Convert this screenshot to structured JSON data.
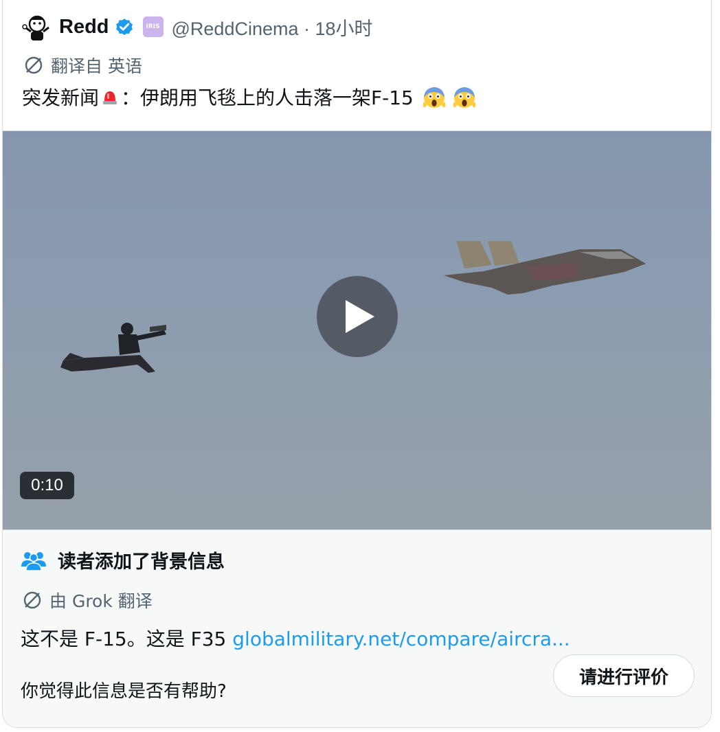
{
  "author": {
    "display_name": "Redd",
    "handle_line": "@ReddCinema · 18小时",
    "org_badge_text": "IRIS"
  },
  "tweet": {
    "translated_from": "翻译自 英语",
    "text_before": "突发新闻",
    "text_after": "：伊朗用飞毯上的人击落一架F-15"
  },
  "media": {
    "duration": "0:10"
  },
  "community_note": {
    "title": "读者添加了背景信息",
    "translated_by": "由 Grok 翻译",
    "body": "这不是 F-15。这是 F35 ",
    "link": "globalmilitary.net/compare/aircra...",
    "helpful_question": "你觉得此信息是否有帮助?",
    "rate_button": "请进行评价"
  },
  "colors": {
    "accent": "#1d9bf0",
    "secondary_text": "#536471",
    "primary_text": "#0f1419"
  },
  "icons": [
    "avatar-icon",
    "verified-badge-icon",
    "org-badge-icon",
    "translate-icon",
    "siren-emoji-icon",
    "scream-emoji-icon",
    "play-icon",
    "people-icon"
  ]
}
